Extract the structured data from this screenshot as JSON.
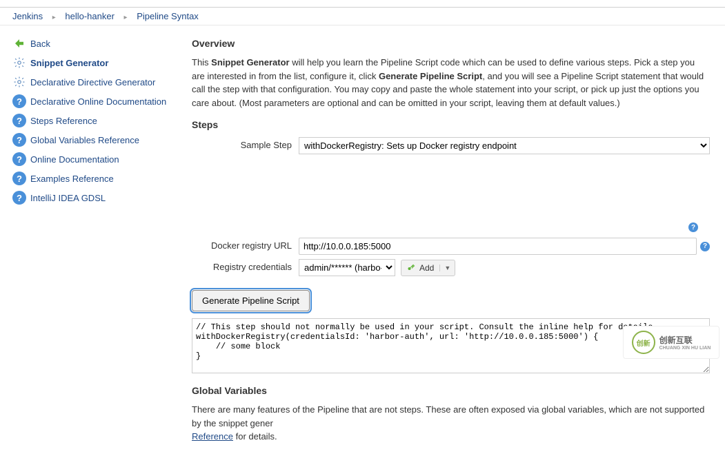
{
  "breadcrumbs": [
    "Jenkins",
    "hello-hanker",
    "Pipeline Syntax"
  ],
  "sidebar": {
    "items": [
      {
        "label": "Back"
      },
      {
        "label": "Snippet Generator"
      },
      {
        "label": "Declarative Directive Generator"
      },
      {
        "label": "Declarative Online Documentation"
      },
      {
        "label": "Steps Reference"
      },
      {
        "label": "Global Variables Reference"
      },
      {
        "label": "Online Documentation"
      },
      {
        "label": "Examples Reference"
      },
      {
        "label": "IntelliJ IDEA GDSL"
      }
    ]
  },
  "overview": {
    "title": "Overview",
    "p1a": "This ",
    "p1b": "Snippet Generator",
    "p1c": " will help you learn the Pipeline Script code which can be used to define various steps. Pick a step you are interested in from the list, configure it, click ",
    "p1d": "Generate Pipeline Script",
    "p1e": ", and you will see a Pipeline Script statement that would call the step with that configuration. You may copy and paste the whole statement into your script, or pick up just the options you care about. (Most parameters are optional and can be omitted in your script, leaving them at default values.)"
  },
  "steps": {
    "title": "Steps",
    "sample_label": "Sample Step",
    "sample_value": "withDockerRegistry: Sets up Docker registry endpoint"
  },
  "docker": {
    "url_label": "Docker registry URL",
    "url_value": "http://10.0.0.185:5000",
    "cred_label": "Registry credentials",
    "cred_value": "admin/****** (harbo-auth)",
    "add_label": "Add"
  },
  "generate": {
    "button": "Generate Pipeline Script",
    "output": "// This step should not normally be used in your script. Consult the inline help for details.\nwithDockerRegistry(credentialsId: 'harbor-auth', url: 'http://10.0.0.185:5000') {\n    // some block\n}"
  },
  "globals": {
    "title": "Global Variables",
    "p1": "There are many features of the Pipeline that are not steps. These are often exposed via global variables, which are not supported by the snippet gener",
    "link": "Reference",
    "p2": " for details."
  },
  "brand": {
    "name": "创新互联",
    "sub": "CHUANG XIN HU LIAN"
  }
}
